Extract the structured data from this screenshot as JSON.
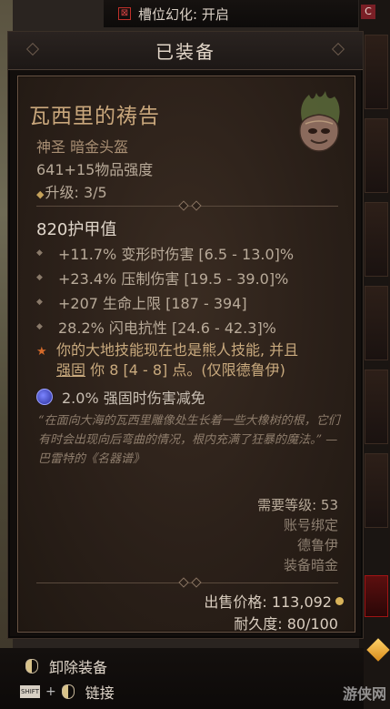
{
  "topbar": {
    "label": "槽位幻化: 开启"
  },
  "window": {
    "title": "已装备"
  },
  "item": {
    "name": "瓦西里的祷告",
    "type": "神圣 暗金头盔",
    "power": "641+15物品强度",
    "upgrade": "升级: 3/5",
    "armor": "820护甲值",
    "stats": [
      "+11.7% 变形时伤害 [6.5 - 13.0]%",
      "+23.4% 压制伤害 [19.5 - 39.0]%",
      "+207 生命上限 [187 - 394]",
      "28.2% 闪电抗性 [24.6 - 42.3]%"
    ],
    "legendary": {
      "line1": "你的大地技能现在也是熊人技能, 并且",
      "line2_under": "强固",
      "line2_rest": " 你 8 [4 - 8] 点。(仅限德鲁伊)"
    },
    "aspect": "2.0% 强固时伤害减免",
    "flavor": "“在面向大海的瓦西里雕像处生长着一些大橡树的根，它们有时会出现向后弯曲的情况，根内充满了狂暴的魔法。” — 巴雷特的《名器谱》",
    "level_req": "需要等级: 53",
    "bound": "账号绑定",
    "class": "德鲁伊",
    "slot": "装备暗金",
    "sell_price": "出售价格:  113,092",
    "durability": "耐久度: 80/100"
  },
  "actions": {
    "unequip": "卸除装备",
    "shift_key": "SHIFT",
    "link": "链接"
  },
  "watermark": "游侠网",
  "colors": {
    "unique_gold": "#c9a77c",
    "legendary_orange": "#d46a2a",
    "aspect_blue": "#7b84ff"
  }
}
